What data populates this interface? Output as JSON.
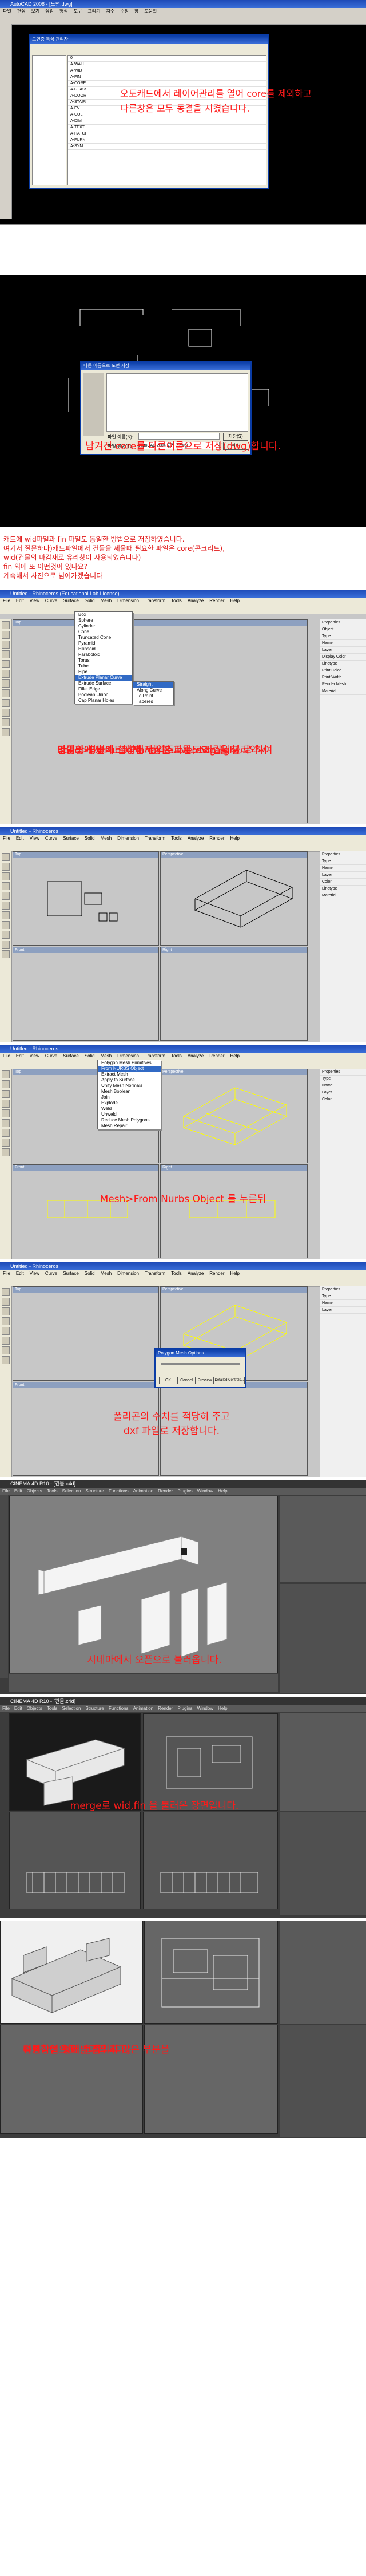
{
  "sections": {
    "s1": {
      "window_title": "AutoCAD 2008 - [도면.dwg]",
      "dialog_title": "도면층 특성 관리자",
      "layers": [
        "0",
        "A-WALL",
        "A-WID",
        "A-FIN",
        "A-CORE",
        "A-GLASS",
        "A-DOOR",
        "A-STAIR",
        "A-EV",
        "A-COL",
        "A-DIM",
        "A-TEXT",
        "A-HATCH",
        "A-FURN",
        "A-SYM"
      ],
      "caption_line1": "오토캐드에서 레이어관리를 열어 core를 제외하고",
      "caption_line2": "다른창은 모두 동결을 시켰습니다."
    },
    "s2": {
      "dialog_title": "다른 이름으로 도면 저장",
      "file_name_label": "파일 이름(N):",
      "file_type_label": "파일 유형(T):",
      "file_type_value": "AutoCAD 2004 도면 (*.dwg)",
      "save_button": "저장(S)",
      "cancel_button": "취소",
      "caption": "남겨진 core를 다른이름으로 저장(dwg)합니다."
    },
    "notes": [
      "캐드에 wid파일과 fin 파일도 동일한 방법으로 저장하였습니다.",
      "여기서 질문하나)캐드파일에서 건물을 세울때 필요한 파일은 core(콘크리트),",
      "wid(건물의 마감재로 유리창이 사용되었습니다)",
      "fin 외에 또 어떤것이 있나요?",
      "계속해서 사진으로 넘어가겠습니다"
    ],
    "s3": {
      "window_title": "Untitled - Rhinoceros (Educational Lab License)",
      "menu": [
        "File",
        "Edit",
        "View",
        "Curve",
        "Surface",
        "Solid",
        "Mesh",
        "Dimension",
        "Transform",
        "Tools",
        "Analyze",
        "Render",
        "Help"
      ],
      "submenu_items": [
        "Box",
        "Sphere",
        "Cylinder",
        "Cone",
        "Truncated Cone",
        "Pyramid",
        "Ellipsoid",
        "Paraboloid",
        "Torus",
        "Tube",
        "Pipe",
        "Extrude Planar Curve",
        "Extrude Surface",
        "Fillet Edge",
        "Boolean Union",
        "Cap Planar Holes"
      ],
      "submenu2_items": [
        "Straight",
        "Along Curve",
        "To Point",
        "Tapered"
      ],
      "caption_lines": [
        "라이노에서 캐드에서 저장한 파일(dwg)을 불러와서",
        "건물의 평면에 그려진 선위주로",
        "Solid>Extrude Planar Curve>Straight 로 하여",
        "명령창에 높이 설정해서 익스트루드 시킵니다."
      ]
    },
    "s4": {
      "window_title": "Untitled - Rhinoceros",
      "viewports": [
        "Top",
        "Perspective",
        "Front",
        "Right"
      ]
    },
    "s5": {
      "window_title": "Untitled - Rhinoceros",
      "submenu_items": [
        "Polygon Mesh Primitives",
        "From NURBS Object",
        "Extract Mesh",
        "Apply to Surface",
        "Unify Mesh Normals",
        "Mesh Boolean",
        "Join",
        "Explode",
        "Weld",
        "Unweld",
        "Reduce Mesh Polygons",
        "Mesh Repair"
      ],
      "caption": "Mesh>From Nurbs Object 를 누른뒤"
    },
    "s6": {
      "dialog_title": "Polygon Mesh Options",
      "ok": "OK",
      "cancel": "Cancel",
      "preview": "Preview",
      "detailed": "Detailed Controls...",
      "caption_line1": "폴리곤의 수치를 적당히 주고",
      "caption_line2": "dxf 파일로 저장합니다."
    },
    "s7": {
      "window_title": "CINEMA 4D R10 - [건물.c4d]",
      "menu": [
        "File",
        "Edit",
        "Objects",
        "Tools",
        "Selection",
        "Structure",
        "Functions",
        "Animation",
        "Render",
        "Plugins",
        "Window",
        "Help"
      ],
      "caption": "시네마에서 오픈으로 불러옵니다."
    },
    "s8": {
      "window_title": "CINEMA 4D R10 - [건물.c4d]",
      "caption": "merge로 wid,fin 을 불러온 장면입니다."
    },
    "s9": {
      "caption_lines": [
        "속성창을 열어 돌출되지 않은 부분을",
        "선택하여 형태를 정리하고,",
        "다른작업으로 넘어갑니다."
      ]
    }
  },
  "colors": {
    "caption": "#ff1a1a",
    "rhino_wire": "#ffff00",
    "acad_bg": "#000000"
  }
}
